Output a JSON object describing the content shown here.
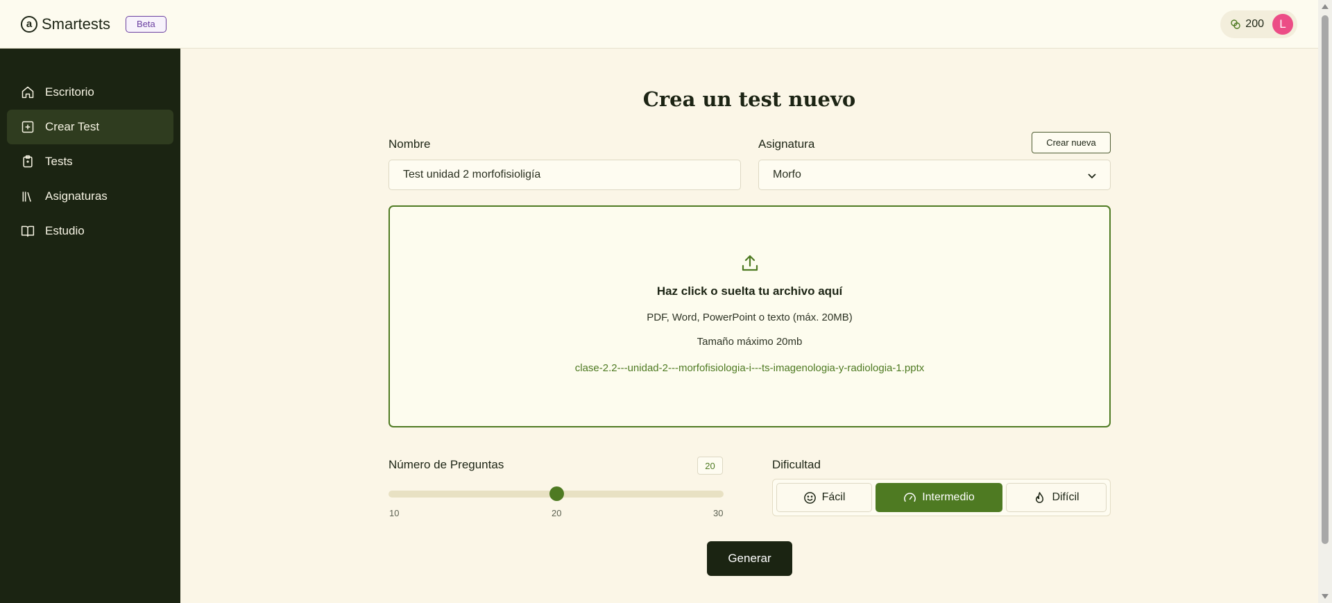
{
  "header": {
    "logo_mark": "a",
    "app_name": "Smartests",
    "badge": "Beta",
    "credits": "200",
    "avatar_initial": "L"
  },
  "sidebar": {
    "items": [
      {
        "label": "Escritorio",
        "icon": "home-icon"
      },
      {
        "label": "Crear Test",
        "icon": "plus-square-icon",
        "active": true
      },
      {
        "label": "Tests",
        "icon": "clipboard-icon"
      },
      {
        "label": "Asignaturas",
        "icon": "library-icon"
      },
      {
        "label": "Estudio",
        "icon": "book-open-icon"
      }
    ]
  },
  "form": {
    "title": "Crea un test nuevo",
    "name_label": "Nombre",
    "name_value": "Test unidad 2 morfofisioligía",
    "subject_label": "Asignatura",
    "subject_value": "Morfo",
    "create_new_label": "Crear nueva"
  },
  "upload": {
    "title": "Haz click o suelta tu archivo aquí",
    "formats": "PDF, Word, PowerPoint o texto (máx. 20MB)",
    "max_size": "Tamaño máximo 20mb",
    "file_name": "clase-2.2---unidad-2---morfofisiologia-i---ts-imagenologia-y-radiologia-1.pptx"
  },
  "questions": {
    "label": "Número de Preguntas",
    "value": "20",
    "min": "10",
    "mid": "20",
    "max": "30"
  },
  "difficulty": {
    "label": "Dificultad",
    "options": [
      {
        "label": "Fácil",
        "icon": "smile-icon"
      },
      {
        "label": "Intermedio",
        "icon": "gauge-icon",
        "selected": true
      },
      {
        "label": "Difícil",
        "icon": "flame-icon"
      }
    ]
  },
  "actions": {
    "generate": "Generar"
  },
  "colors": {
    "accent": "#4e7a22",
    "sidebar_bg": "#1b2412",
    "page_bg": "#fbf6e7",
    "avatar": "#ec4d86",
    "beta": "#6a3fa0"
  }
}
